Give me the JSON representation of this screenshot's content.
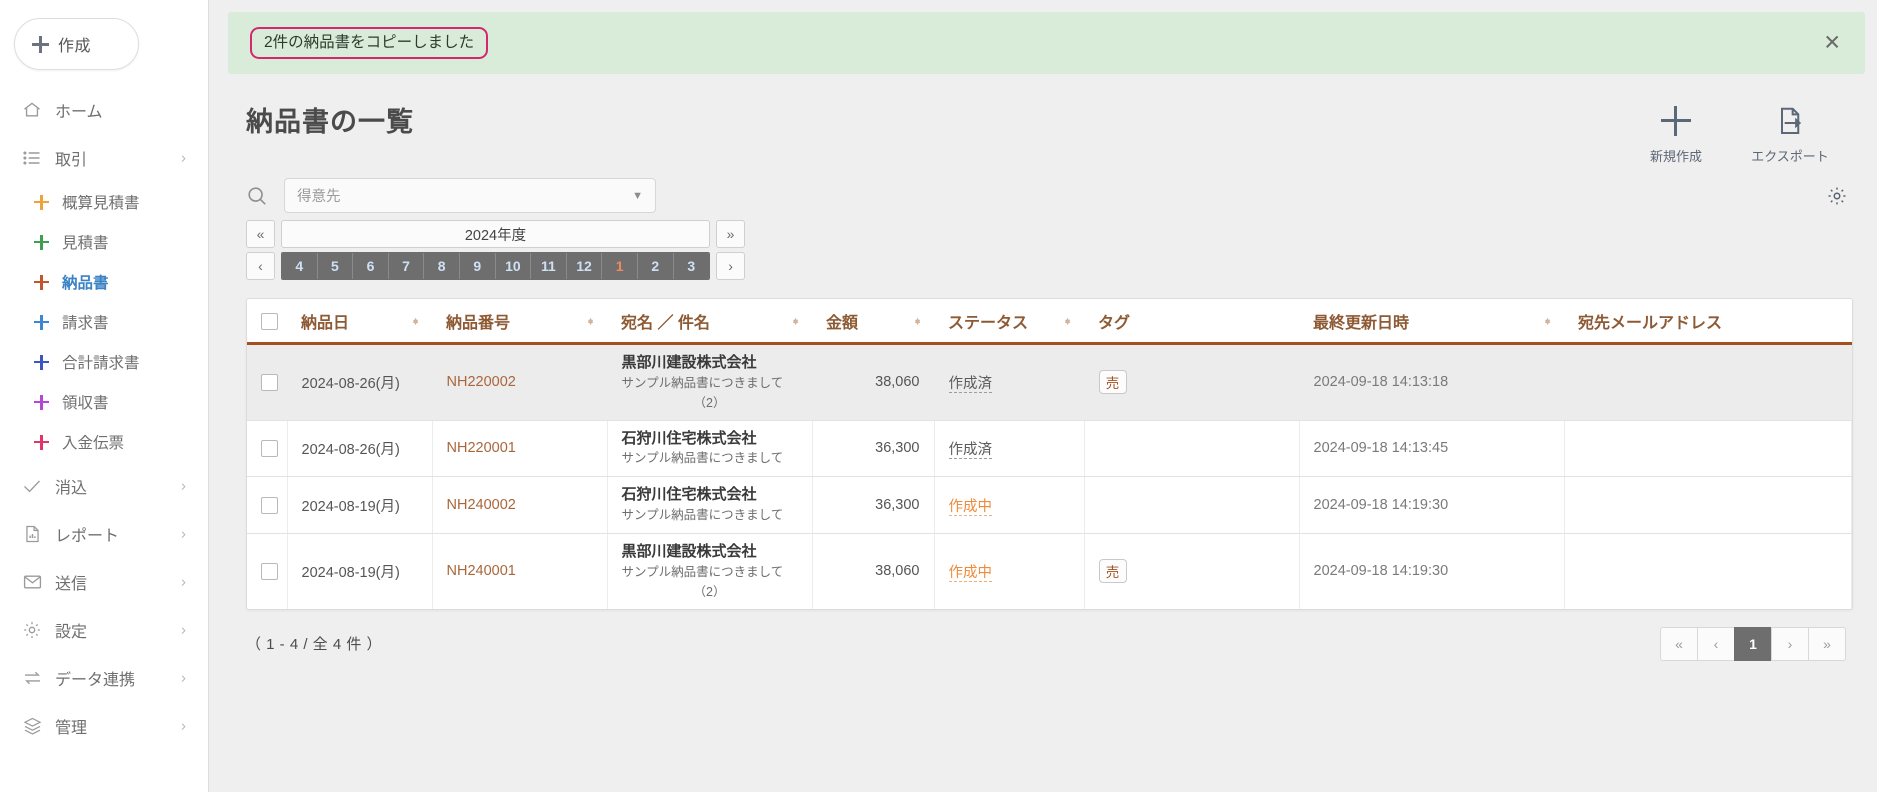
{
  "sidebar": {
    "create_button": "作成",
    "items": [
      {
        "label": "ホーム",
        "icon": "home-icon",
        "chevron": false,
        "type": "top"
      },
      {
        "label": "取引",
        "icon": "list-icon",
        "chevron": true,
        "type": "top"
      },
      {
        "label": "概算見積書",
        "icon": "plus-icon",
        "color": "#eda33a",
        "type": "sub"
      },
      {
        "label": "見積書",
        "icon": "plus-icon",
        "color": "#3f9e52",
        "type": "sub"
      },
      {
        "label": "納品書",
        "icon": "plus-icon",
        "color": "#c2552a",
        "type": "sub",
        "active": true
      },
      {
        "label": "請求書",
        "icon": "plus-icon",
        "color": "#3b86d6",
        "type": "sub"
      },
      {
        "label": "合計請求書",
        "icon": "plus-icon",
        "color": "#3b56c4",
        "type": "sub"
      },
      {
        "label": "領収書",
        "icon": "plus-icon",
        "color": "#b348d6",
        "type": "sub"
      },
      {
        "label": "入金伝票",
        "icon": "plus-icon",
        "color": "#e0356a",
        "type": "sub"
      },
      {
        "label": "消込",
        "icon": "check-icon",
        "chevron": true,
        "type": "top"
      },
      {
        "label": "レポート",
        "icon": "report-icon",
        "chevron": true,
        "type": "top"
      },
      {
        "label": "送信",
        "icon": "mail-icon",
        "chevron": true,
        "type": "top"
      },
      {
        "label": "設定",
        "icon": "gear-icon",
        "chevron": true,
        "type": "top"
      },
      {
        "label": "データ連携",
        "icon": "exchange-icon",
        "chevron": true,
        "type": "top"
      },
      {
        "label": "管理",
        "icon": "layers-icon",
        "chevron": true,
        "type": "top"
      }
    ]
  },
  "alert": {
    "message": "2件の納品書をコピーしました",
    "close_label": "✕",
    "bg_color": "#d8ecd9",
    "annotation_color": "#d6276e"
  },
  "header": {
    "title": "納品書の一覧",
    "actions": [
      {
        "label": "新規作成",
        "icon": "plus-icon"
      },
      {
        "label": "エクスポート",
        "icon": "export-document-icon"
      }
    ],
    "settings_icon": "gear-icon"
  },
  "filters": {
    "search_icon": "search-icon",
    "customer_select": {
      "placeholder": "得意先",
      "value": "",
      "caret": "▼"
    },
    "period": {
      "prev_year_label": "«",
      "next_year_label": "»",
      "prev_month_label": "‹",
      "next_month_label": "›",
      "year_label": "2024年度",
      "months": [
        {
          "label": "4",
          "tone": "cool"
        },
        {
          "label": "5",
          "tone": "cool"
        },
        {
          "label": "6",
          "tone": "cool"
        },
        {
          "label": "7",
          "tone": "cool"
        },
        {
          "label": "8",
          "tone": "cool"
        },
        {
          "label": "9",
          "tone": "cool"
        },
        {
          "label": "10",
          "tone": "cool"
        },
        {
          "label": "11",
          "tone": "cool"
        },
        {
          "label": "12",
          "tone": "cool"
        },
        {
          "label": "1",
          "tone": "warm"
        },
        {
          "label": "2",
          "tone": "cool"
        },
        {
          "label": "3",
          "tone": "cool"
        }
      ]
    }
  },
  "table": {
    "select_all_checkbox": false,
    "columns": [
      {
        "key": "checkbox",
        "label": "",
        "sortable": false
      },
      {
        "key": "delivery_date",
        "label": "納品日",
        "sortable": true
      },
      {
        "key": "doc_number",
        "label": "納品番号",
        "sortable": true
      },
      {
        "key": "addressee",
        "label": "宛名 ／ 件名",
        "sortable": true
      },
      {
        "key": "amount",
        "label": "金額",
        "sortable": true
      },
      {
        "key": "status",
        "label": "ステータス",
        "sortable": true
      },
      {
        "key": "tag",
        "label": "タグ",
        "sortable": false
      },
      {
        "key": "updated_at",
        "label": "最終更新日時",
        "sortable": true
      },
      {
        "key": "email",
        "label": "宛先メールアドレス",
        "sortable": false
      }
    ],
    "rows": [
      {
        "highlighted": true,
        "checked": false,
        "delivery_date": "2024-08-26(月)",
        "doc_number": "NH220002",
        "addressee": "黒部川建設株式会社",
        "subject": "サンプル納品書につきまして",
        "subject2": "（2）",
        "amount": "38,060",
        "status": "作成済",
        "status_kind": "done",
        "tag": "売",
        "updated_at": "2024-09-18 14:13:18",
        "email": ""
      },
      {
        "highlighted": false,
        "checked": false,
        "delivery_date": "2024-08-26(月)",
        "doc_number": "NH220001",
        "addressee": "石狩川住宅株式会社",
        "subject": "サンプル納品書につきまして",
        "subject2": "",
        "amount": "36,300",
        "status": "作成済",
        "status_kind": "done",
        "tag": "",
        "updated_at": "2024-09-18 14:13:45",
        "email": ""
      },
      {
        "highlighted": false,
        "checked": false,
        "delivery_date": "2024-08-19(月)",
        "doc_number": "NH240002",
        "addressee": "石狩川住宅株式会社",
        "subject": "サンプル納品書につきまして",
        "subject2": "",
        "amount": "36,300",
        "status": "作成中",
        "status_kind": "wip",
        "tag": "",
        "updated_at": "2024-09-18 14:19:30",
        "email": ""
      },
      {
        "highlighted": false,
        "checked": false,
        "delivery_date": "2024-08-19(月)",
        "doc_number": "NH240001",
        "addressee": "黒部川建設株式会社",
        "subject": "サンプル納品書につきまして",
        "subject2": "（2）",
        "amount": "38,060",
        "status": "作成中",
        "status_kind": "wip",
        "tag": "売",
        "updated_at": "2024-09-18 14:19:30",
        "email": ""
      }
    ]
  },
  "footer": {
    "count_text": "（ 1 - 4 / 全 4 件 ）",
    "pagination": {
      "first": "«",
      "prev": "‹",
      "pages": [
        "1"
      ],
      "current": "1",
      "next": "›",
      "last": "»"
    }
  },
  "theme": {
    "accent_brown": "#a2501f",
    "link_brown": "#a9663a",
    "status_wip": "#ef8b3c",
    "alert_green": "#d8ecd9",
    "annotation_pink": "#d6276e"
  }
}
